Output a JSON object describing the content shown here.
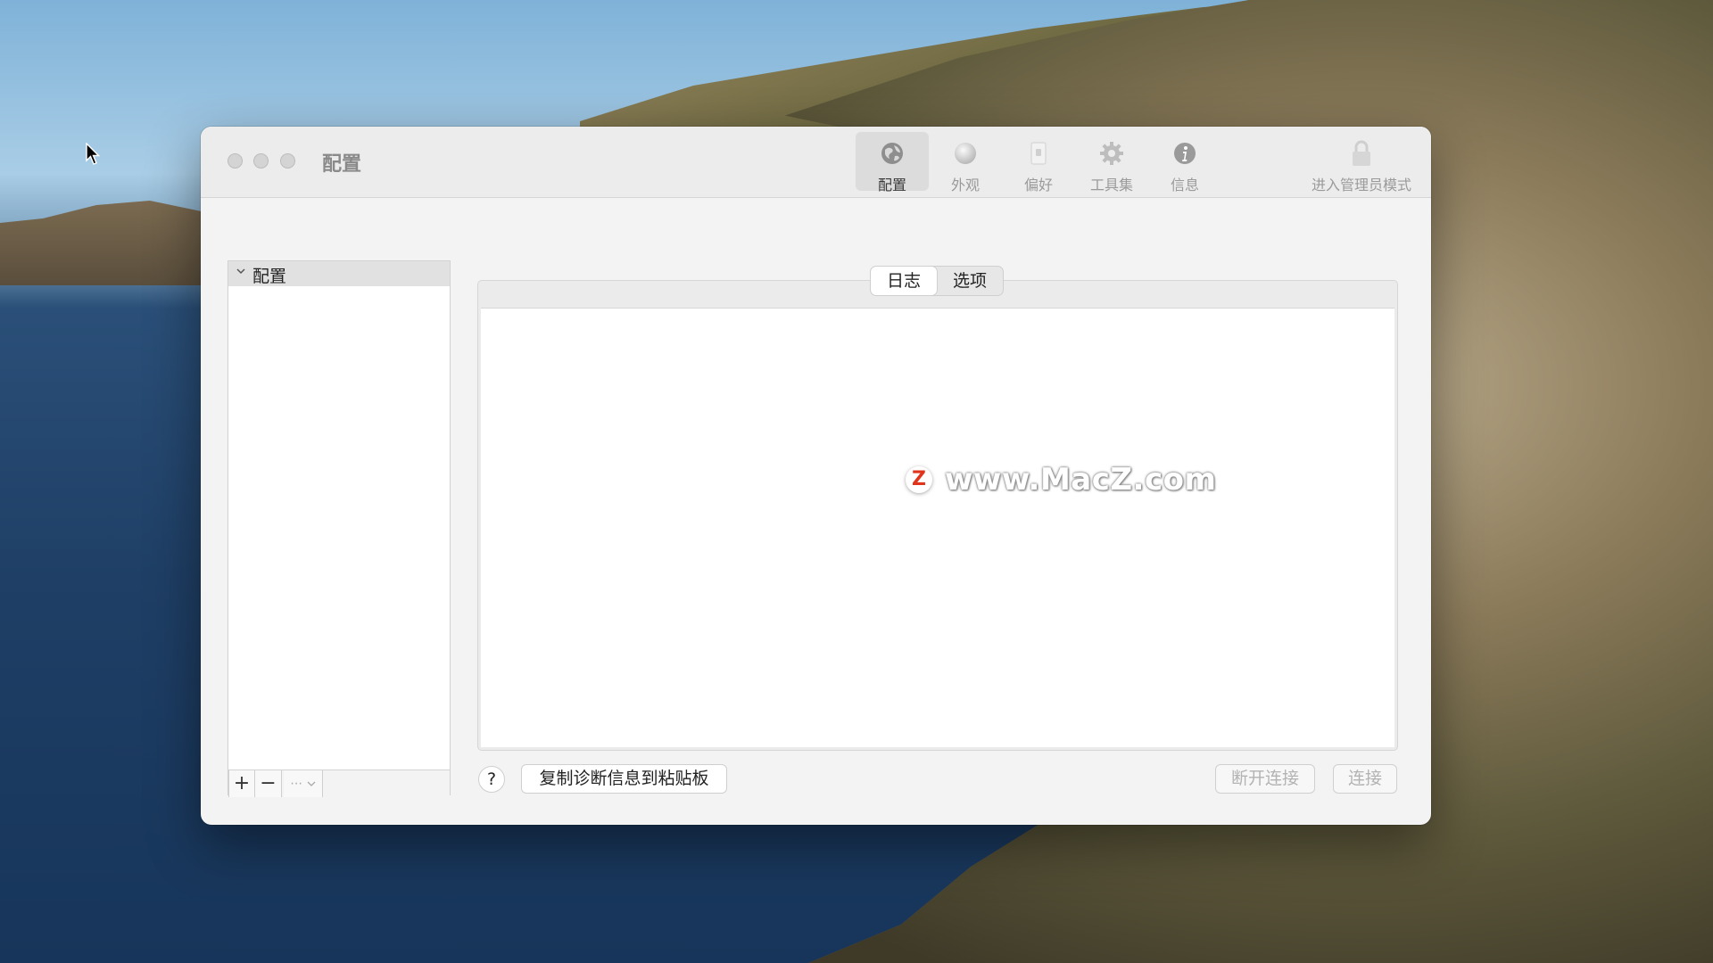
{
  "window": {
    "title": "配置"
  },
  "toolbar": {
    "items": [
      {
        "label": "配置",
        "icon": "globe-icon"
      },
      {
        "label": "外观",
        "icon": "sphere-icon"
      },
      {
        "label": "偏好",
        "icon": "switch-icon"
      },
      {
        "label": "工具集",
        "icon": "gear-icon"
      },
      {
        "label": "信息",
        "icon": "info-icon"
      }
    ],
    "admin_label": "进入管理员模式"
  },
  "sidebar": {
    "header_label": "配置",
    "footer": {
      "add": "+",
      "remove": "−",
      "more": "⋯"
    }
  },
  "tabs": {
    "log": "日志",
    "options": "选项"
  },
  "watermark": {
    "badge": "Z",
    "text": "www.MacZ.com"
  },
  "bottom": {
    "help": "?",
    "copy_diag": "复制诊断信息到粘贴板",
    "disconnect": "断开连接",
    "connect": "连接"
  }
}
